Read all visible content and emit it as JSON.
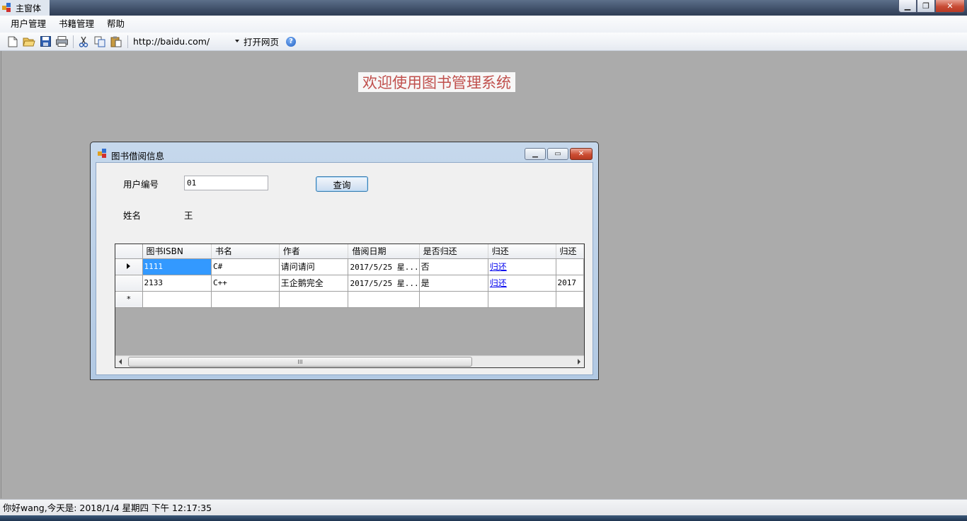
{
  "window": {
    "title": "主窗体"
  },
  "menubar": {
    "items": [
      "用户管理",
      "书籍管理",
      "帮助"
    ]
  },
  "toolbar": {
    "icons": [
      "new-file-icon",
      "open-folder-icon",
      "save-icon",
      "print-icon",
      "cut-icon",
      "copy-icon",
      "paste-icon"
    ],
    "url": "http://baidu.com/",
    "open_page_label": "打开网页",
    "help_icon": "help-icon"
  },
  "welcome_text": "欢迎使用图书管理系统",
  "child_window": {
    "title": "图书借阅信息",
    "user_id_label": "用户编号",
    "user_id_value": "01",
    "query_label": "查询",
    "name_label": "姓名",
    "name_value": "王",
    "grid": {
      "columns": [
        "图书ISBN",
        "书名",
        "作者",
        "借阅日期",
        "是否归还",
        "归还",
        "归还"
      ],
      "rows": [
        [
          "1111",
          "C#",
          "请问请问",
          "2017/5/25 星...",
          "否",
          "归还",
          ""
        ],
        [
          "2133",
          "C++",
          "王企鹅完全",
          "2017/5/25 星...",
          "是",
          "归还",
          "2017"
        ]
      ],
      "new_row_marker": "*",
      "scroll_grip": "III"
    }
  },
  "statusbar": {
    "text": "你好wang,今天是:  2018/1/4 星期四 下午 12:17:35"
  },
  "colors": {
    "welcome_text": "#c0504d",
    "selection": "#3399ff",
    "link": "#0000ee"
  }
}
